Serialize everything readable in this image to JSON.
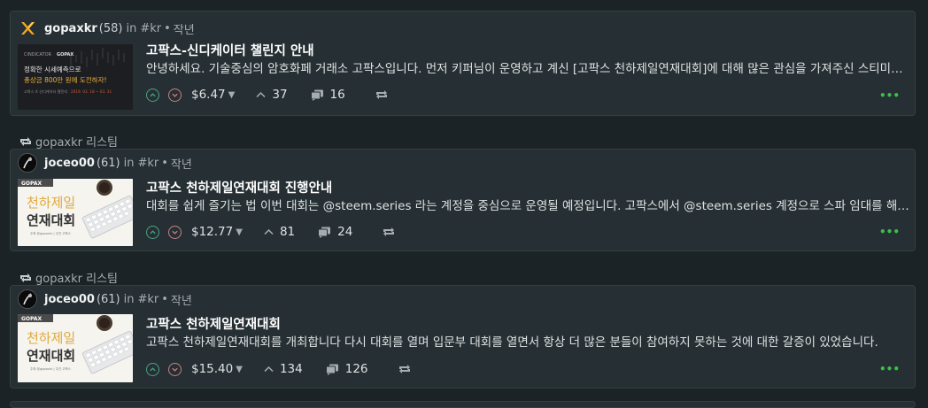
{
  "posts": [
    {
      "reblog": null,
      "author": "gopaxkr",
      "reputation": "(58)",
      "in_word": "in",
      "tag": "#kr",
      "separator": "•",
      "time": "작년",
      "avatar_icon": "gopax-logo-icon",
      "thumbnail": {
        "style": "dark",
        "lines": [
          "CINDICATOR",
          "GOPAX",
          "정확한 시세예측으로",
          "총상금 800만 원에 도전하자!",
          "고팍스 X 신디케이터 챌린지",
          "2019. 03. 18 ~ 03. 31"
        ]
      },
      "title": "고팍스-신디케이터 챌린지 안내",
      "summary": "안녕하세요. 기술중심의 암호화페 거래소 고팍스입니다. 먼저 키퍼님이 운영하고 계신 [고팍스 천하제일연재대회]에 대해 많은 관심을 가져주신 스티미언 여러분께 감사드립니다.",
      "payout": "$6.47",
      "votes": "37",
      "comments": "16"
    },
    {
      "reblog": "gopaxkr 리스팀",
      "author": "joceo00",
      "reputation": "(61)",
      "in_word": "in",
      "tag": "#kr",
      "separator": "•",
      "time": "작년",
      "avatar_icon": "joceo-avatar-icon",
      "thumbnail": {
        "style": "light",
        "lines": [
          "GOPAX",
          "천하제일",
          "연재대회",
          "주최 @gopaxkr | 주관 고팍스"
        ]
      },
      "title": "고팍스 천하제일연재대회 진행안내",
      "summary": "대회를 쉽게 즐기는 법 이번 대회는 @steem.series 라는 계정을 중심으로 운영될 예정입니다. 고팍스에서 @steem.series 계정으로 스파 임대를 해주셨습니다.",
      "payout": "$12.77",
      "votes": "81",
      "comments": "24"
    },
    {
      "reblog": "gopaxkr 리스팀",
      "author": "joceo00",
      "reputation": "(61)",
      "in_word": "in",
      "tag": "#kr",
      "separator": "•",
      "time": "작년",
      "avatar_icon": "joceo-avatar-icon",
      "thumbnail": {
        "style": "light",
        "lines": [
          "GOPAX",
          "천하제일",
          "연재대회",
          "주최 @gopaxkr | 주관 고팍스"
        ]
      },
      "title": "고팍스 천하제일연재대회",
      "summary": "고팍스 천하제일연재대회를 개최합니다 다시 대회를 열며 입문부 대회를 열면서 항상 더 많은 분들이 참여하지 못하는 것에 대한 갈증이 있었습니다.",
      "payout": "$15.40",
      "votes": "134",
      "comments": "126"
    }
  ],
  "colors": {
    "background": "#1c2327",
    "card": "#262f33",
    "upvote": "#4ba385",
    "downvote": "#c97f86",
    "more": "#3dbd4a"
  },
  "icons": {
    "reblog": "reblog-icon",
    "upvote": "chevron-up-circle-icon",
    "downvote": "chevron-down-circle-icon",
    "votes": "chevron-up-icon",
    "comments": "comments-icon",
    "resteem": "resteem-icon",
    "more": "more-dots-icon"
  }
}
